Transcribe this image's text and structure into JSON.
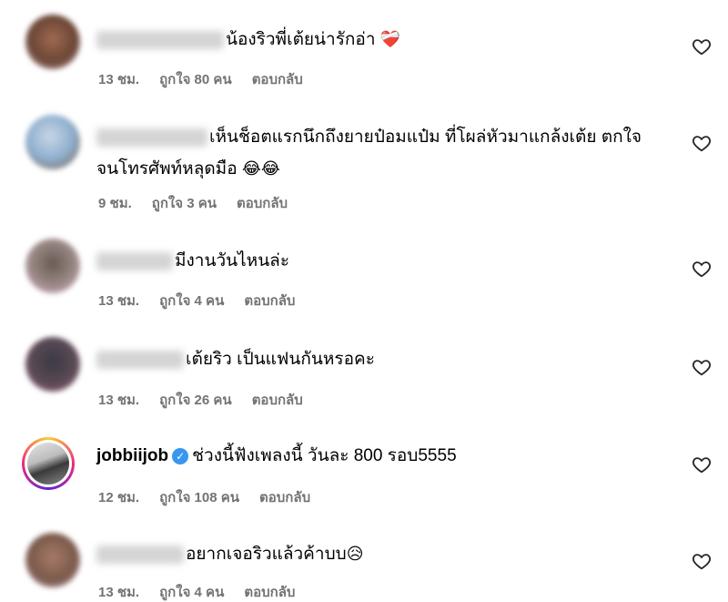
{
  "comments": [
    {
      "text": "น้องริวพี่เต้ยน่ารักอ่า",
      "emoji": "❤️‍🩹",
      "time": "13 ชม.",
      "likes": "ถูกใจ 80 คน",
      "reply": "ตอบกลับ"
    },
    {
      "text": "เห็นช็อตแรกนึกถึงยายป๋อมแป๋ม ที่โผล่หัวมาแกล้งเต้ย ตกใจจนโทรศัพท์หลุดมือ",
      "emoji": "😂😂",
      "time": "9 ชม.",
      "likes": "ถูกใจ 3 คน",
      "reply": "ตอบกลับ"
    },
    {
      "text": "มีงานวันไหนล่ะ",
      "emoji": "",
      "time": "13 ชม.",
      "likes": "ถูกใจ 4 คน",
      "reply": "ตอบกลับ"
    },
    {
      "text": "เต้ยริว เป็นแฟนกันหรอคะ",
      "emoji": "",
      "time": "13 ชม.",
      "likes": "ถูกใจ 26 คน",
      "reply": "ตอบกลับ"
    },
    {
      "username": "jobbiijob",
      "text": "ช่วงนี้ฟังเพลงนี้ วันละ 800 รอบ5555",
      "emoji": "",
      "time": "12 ชม.",
      "likes": "ถูกใจ 108 คน",
      "reply": "ตอบกลับ"
    },
    {
      "text": "อยากเจอริวแล้วค้าบบ",
      "emoji": "😥",
      "time": "13 ชม.",
      "likes": "ถูกใจ 4 คน",
      "reply": "ตอบกลับ"
    }
  ],
  "colors": {
    "meta": "#737373",
    "verified": "#3897f0"
  },
  "icons": {
    "like": "heart-outline-icon",
    "verified": "verified-badge-icon"
  }
}
